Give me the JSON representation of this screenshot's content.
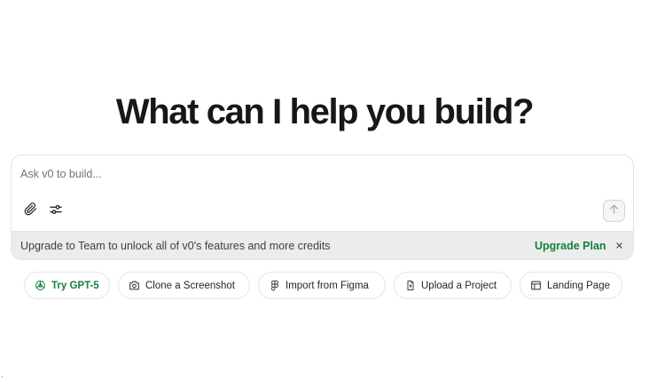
{
  "hero": {
    "title": "What can I help you build?"
  },
  "composer": {
    "placeholder": "Ask v0 to build...",
    "value": "",
    "attach_icon": "paperclip-icon",
    "settings_icon": "sliders-icon",
    "send_icon": "arrow-up-icon"
  },
  "upgrade": {
    "message": "Upgrade to Team to unlock all of v0's features and more credits",
    "cta_label": "Upgrade Plan",
    "dismiss_icon": "close-icon"
  },
  "chips": {
    "gpt": {
      "label": "Try GPT-5",
      "icon": "openai-icon"
    },
    "clone": {
      "label": "Clone a Screenshot",
      "icon": "camera-icon"
    },
    "figma": {
      "label": "Import from Figma",
      "icon": "figma-icon"
    },
    "upload": {
      "label": "Upload a Project",
      "icon": "file-upload-icon"
    },
    "landing": {
      "label": "Landing Page",
      "icon": "layout-icon"
    }
  },
  "colors": {
    "accent_green": "#15803d",
    "text": "#171717",
    "muted": "#737373",
    "border": "#e5e5e5",
    "bar_bg": "#ececec"
  }
}
